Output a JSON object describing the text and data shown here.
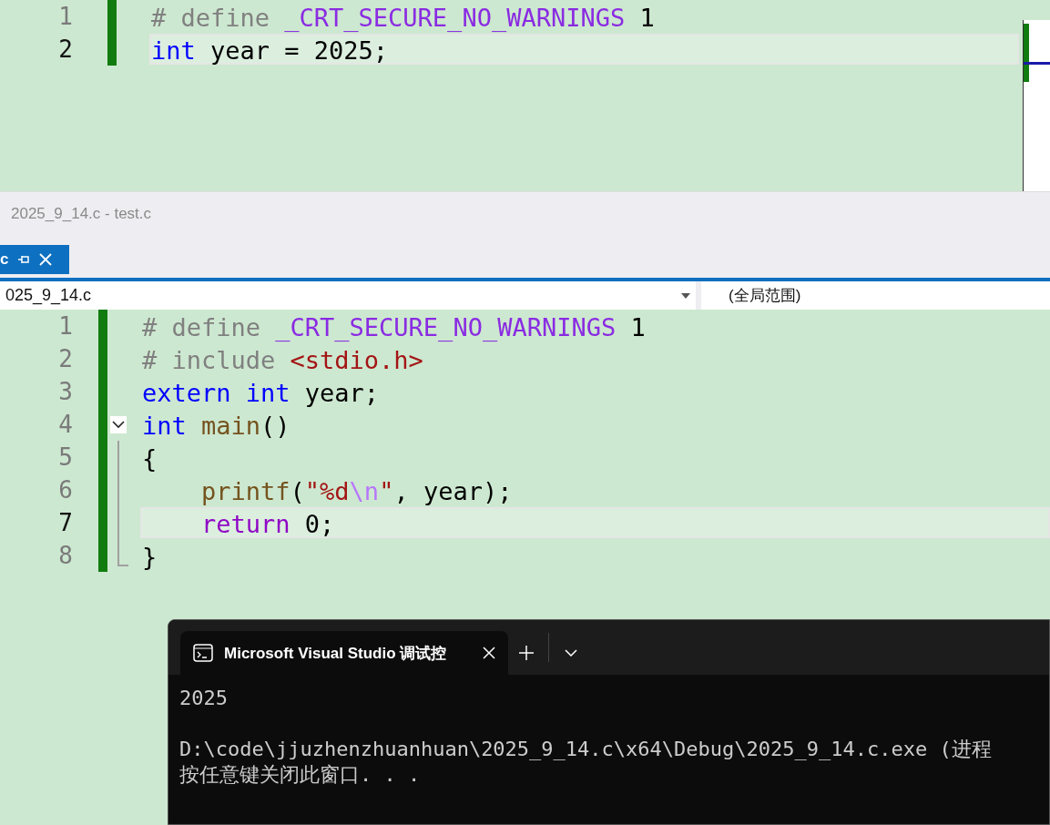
{
  "top_editor": {
    "lines": [
      {
        "number": "1",
        "current": false,
        "tokens": [
          {
            "text": "# define ",
            "kind": "preproc"
          },
          {
            "text": "_CRT_SECURE_NO_WARNINGS",
            "kind": "macro"
          },
          {
            "text": " 1",
            "kind": "text"
          }
        ]
      },
      {
        "number": "2",
        "current": true,
        "tokens": [
          {
            "text": "int",
            "kind": "keyword"
          },
          {
            "text": " year = 2025;",
            "kind": "text"
          }
        ]
      }
    ]
  },
  "document_title": "2025_9_14.c - test.c",
  "file_tab": {
    "label": "c",
    "selected": true
  },
  "navigation_bar": {
    "file": "025_9_14.c",
    "scope": "(全局范围)"
  },
  "bottom_editor": {
    "lines": [
      {
        "number": "1",
        "current": false,
        "fold_start": false,
        "tokens": [
          {
            "text": "# define ",
            "kind": "preproc"
          },
          {
            "text": "_CRT_SECURE_NO_WARNINGS",
            "kind": "macro"
          },
          {
            "text": " 1",
            "kind": "text"
          }
        ]
      },
      {
        "number": "2",
        "current": false,
        "fold_start": false,
        "tokens": [
          {
            "text": "# include ",
            "kind": "preproc"
          },
          {
            "text": "<stdio.h>",
            "kind": "string"
          }
        ]
      },
      {
        "number": "3",
        "current": false,
        "fold_start": false,
        "tokens": [
          {
            "text": "extern ",
            "kind": "keyword"
          },
          {
            "text": "int",
            "kind": "keyword"
          },
          {
            "text": " year;",
            "kind": "text"
          }
        ]
      },
      {
        "number": "4",
        "current": false,
        "fold_start": true,
        "tokens": [
          {
            "text": "int ",
            "kind": "keyword"
          },
          {
            "text": "main",
            "kind": "function"
          },
          {
            "text": "()",
            "kind": "text"
          }
        ]
      },
      {
        "number": "5",
        "current": false,
        "fold_start": false,
        "tokens": [
          {
            "text": "{",
            "kind": "text"
          }
        ]
      },
      {
        "number": "6",
        "current": false,
        "fold_start": false,
        "tokens": [
          {
            "text": "    printf",
            "kind": "function"
          },
          {
            "text": "(",
            "kind": "text"
          },
          {
            "text": "\"%d",
            "kind": "string"
          },
          {
            "text": "\\n",
            "kind": "escape"
          },
          {
            "text": "\"",
            "kind": "string"
          },
          {
            "text": ", year);",
            "kind": "text"
          }
        ]
      },
      {
        "number": "7",
        "current": true,
        "fold_start": false,
        "tokens": [
          {
            "text": "    return",
            "kind": "control"
          },
          {
            "text": " 0;",
            "kind": "text"
          }
        ]
      },
      {
        "number": "8",
        "current": false,
        "fold_start": false,
        "tokens": [
          {
            "text": "}",
            "kind": "text"
          }
        ]
      }
    ]
  },
  "terminal": {
    "tab_title": "Microsoft Visual Studio 调试控",
    "output": [
      "2025",
      "D:\\code\\jjuzhenzhuanhuan\\2025_9_14.c\\x64\\Debug\\2025_9_14.c.exe (进程",
      "按任意键关闭此窗口. . ."
    ]
  }
}
